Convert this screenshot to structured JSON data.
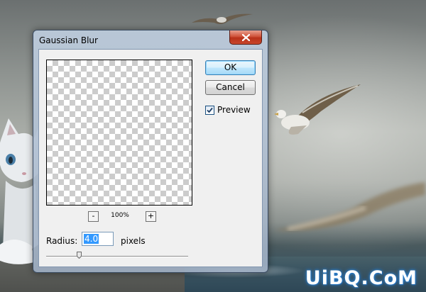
{
  "dialog": {
    "title": "Gaussian Blur",
    "ok_label": "OK",
    "cancel_label": "Cancel",
    "preview_label": "Preview",
    "preview_checked": true,
    "zoom_out_label": "-",
    "zoom_in_label": "+",
    "zoom_level": "100%",
    "radius_label": "Radius:",
    "radius_value": "4.0",
    "radius_unit": "pixels",
    "radius_slider_fraction": 0.23
  },
  "watermark": "UiBQ.CoM",
  "colors": {
    "close_button": "#c9472c",
    "ok_button_border": "#3c7fb1",
    "selection": "#3399ff"
  }
}
